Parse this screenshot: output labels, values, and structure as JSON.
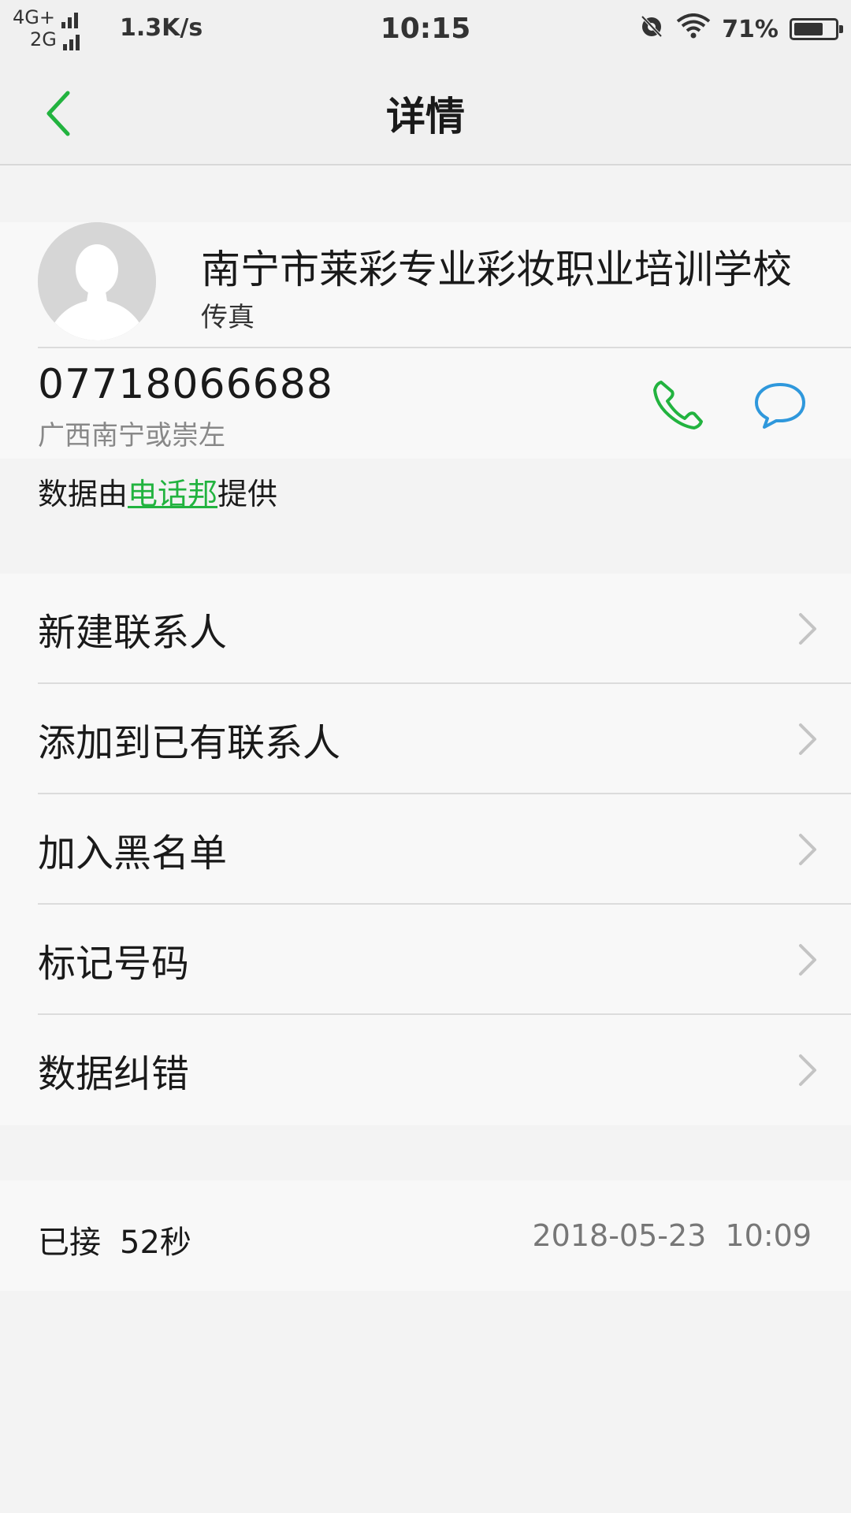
{
  "status_bar": {
    "network_1": "4G+",
    "network_2": "2G",
    "speed": "1.3K/s",
    "time": "10:15",
    "battery": "71%",
    "battery_level": 0.71,
    "icons": [
      "signal-icon",
      "alarm-off-icon",
      "wifi-icon",
      "battery-icon"
    ]
  },
  "header": {
    "title": "详情",
    "back_icon": "chevron-left-icon"
  },
  "contact": {
    "name": "南宁市莱彩专业彩妆职业培训学校",
    "type": "传真",
    "number": "07718066688",
    "location": "广西南宁或崇左",
    "call_icon": "phone-icon",
    "message_icon": "message-icon"
  },
  "source": {
    "prefix": "数据由",
    "link": "电话邦",
    "suffix": "提供"
  },
  "menu": {
    "items": [
      {
        "label": "新建联系人"
      },
      {
        "label": "添加到已有联系人"
      },
      {
        "label": "加入黑名单"
      },
      {
        "label": "标记号码"
      },
      {
        "label": "数据纠错"
      }
    ]
  },
  "call_log": {
    "status": "已接",
    "duration": "52秒",
    "datetime": "2018-05-23  10:09"
  },
  "colors": {
    "accent_green": "#22b33f",
    "message_blue": "#2f98dc",
    "background": "#f3f3f3",
    "card": "#f8f8f8"
  }
}
